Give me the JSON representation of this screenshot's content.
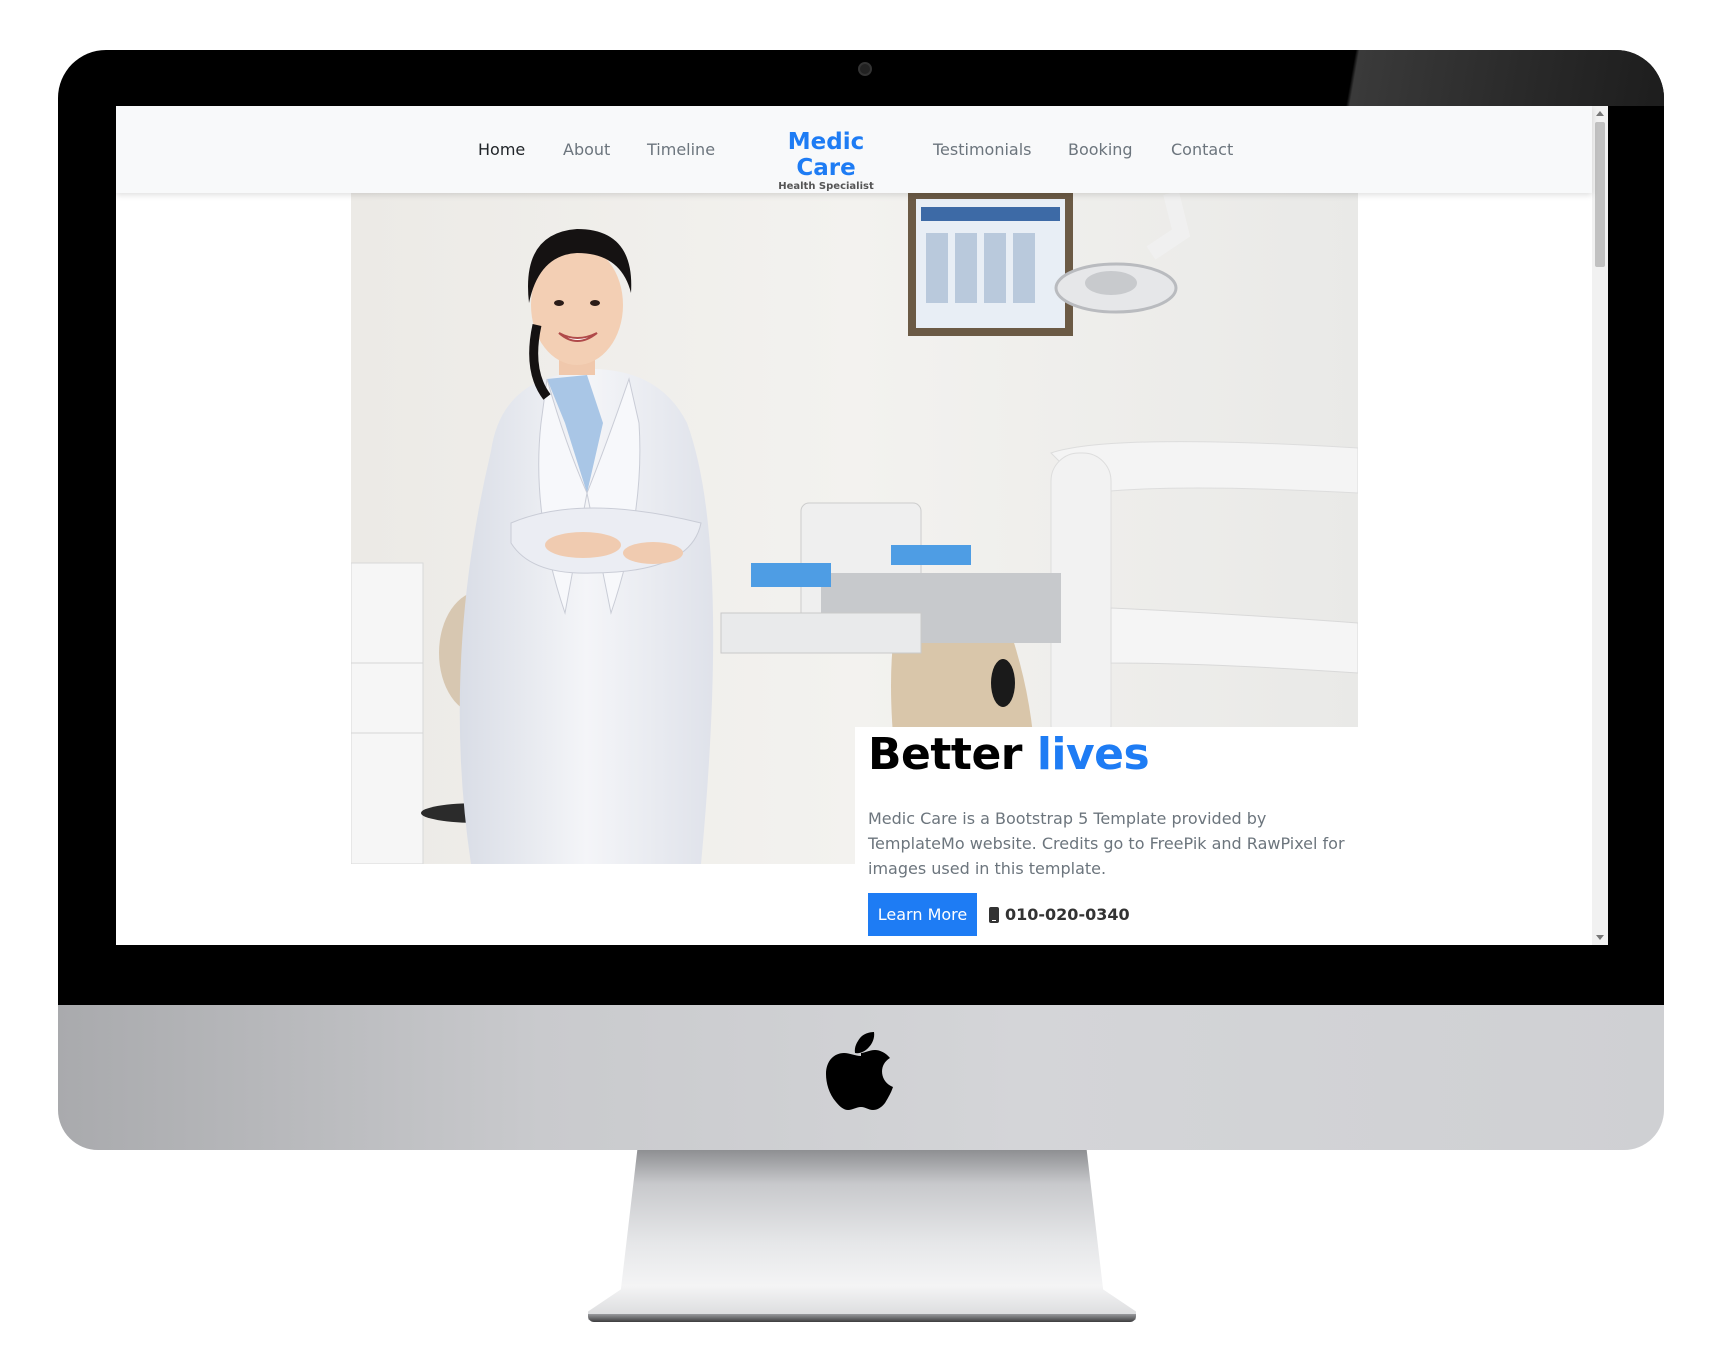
{
  "navbar": {
    "items": [
      {
        "label": "Home",
        "active": true
      },
      {
        "label": "About"
      },
      {
        "label": "Timeline"
      },
      {
        "label": "Testimonials"
      },
      {
        "label": "Booking"
      },
      {
        "label": "Contact"
      }
    ],
    "brand": {
      "title": "Medic Care",
      "subtitle": "Health Specialist"
    }
  },
  "hero": {
    "title_main": "Better",
    "title_accent": "lives",
    "description": "Medic Care is a Bootstrap 5 Template provided by TemplateMo website. Credits go to FreePik and RawPixel for images used in this template.",
    "button_label": "Learn More",
    "phone": "010-020-0340",
    "phone_icon": "phone-icon"
  },
  "colors": {
    "accent": "#1e7cf4",
    "navbar_bg": "#f8f9fa",
    "text_muted": "#6c757d"
  }
}
